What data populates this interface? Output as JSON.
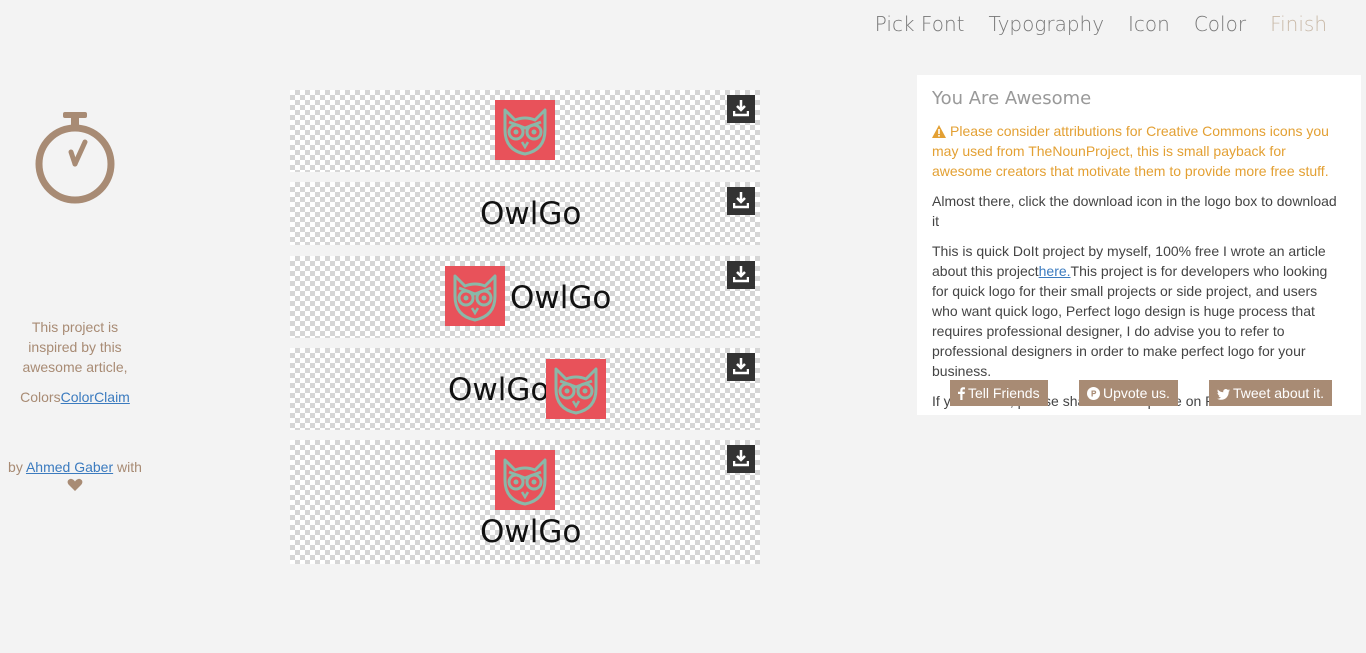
{
  "nav": {
    "items": [
      {
        "label": "Pick Font",
        "active": false
      },
      {
        "label": "Typography",
        "active": false
      },
      {
        "label": "Icon",
        "active": false
      },
      {
        "label": "Color",
        "active": false
      },
      {
        "label": "Finish",
        "active": true
      }
    ]
  },
  "sidebar": {
    "icon": "stopwatch-icon",
    "inspired_text": "This project is inspired by this awesome article,",
    "colors_prefix": "Colors",
    "colors_link": "ColorClaim",
    "by_prefix": "by",
    "author_link": "Ahmed Gaber",
    "by_suffix": "with",
    "heart_icon": "heart-icon"
  },
  "logos": {
    "brand_name": "OwlGo",
    "icon": "owl-icon",
    "icon_bg": "#e8525a",
    "icon_stroke": "#8ab8a8",
    "download_icon": "download-icon",
    "variants": [
      "icon-only",
      "text-only",
      "icon-left",
      "icon-right",
      "icon-top"
    ]
  },
  "panel": {
    "title": "You Are Awesome",
    "warning_icon": "warning-icon",
    "warning": "Please consider attributions for Creative Commons icons you may used from TheNounProject, this is small payback for awesome creators that motivate them to provide more free stuff.",
    "instruction": "Almost there, click the download icon in the logo box to download it",
    "about_prefix": "This is quick DoIt project by myself, 100% free I wrote an article about this project",
    "about_link": "here.",
    "about_suffix": "This project is for developers who looking for quick logo for their small projects or side project, and users who want quick logo, Perfect logo design is huge process that requires professional designer, I do advise you to refer to professional designers in order to make perfect logo for your business.",
    "share_text": "If you liked it, please share it and upvote on ProductHunt.",
    "buttons": {
      "facebook": "Tell Friends",
      "producthunt": "Upvote us.",
      "twitter": "Tweet about it."
    }
  },
  "colors": {
    "accent": "#a88b74",
    "link": "#3b7bbf",
    "warning": "#e3a033"
  }
}
